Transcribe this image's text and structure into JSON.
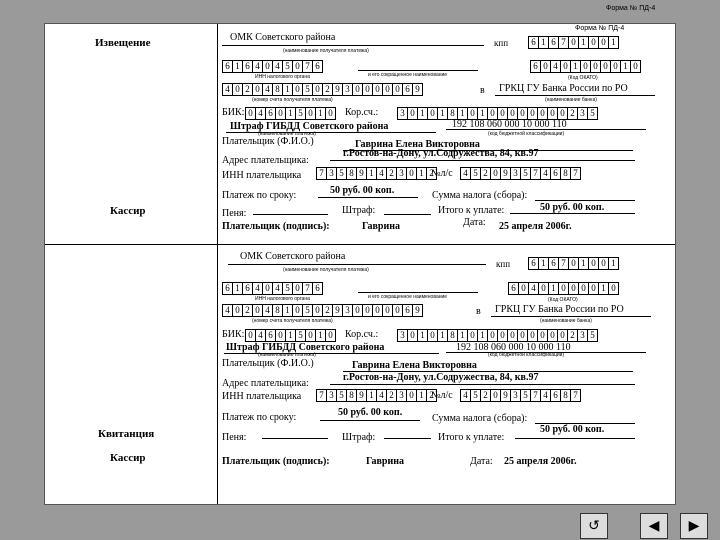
{
  "outer_title": "Форма № ПД-4",
  "form_title": "Форма № ПД-4",
  "section1_label": "Извещение",
  "section1_cashier": "Кассир",
  "section2_label": "Квитанция",
  "section2_cashier": "Кассир",
  "recipient": "ОМК Советского района",
  "recipient_caption": "(наименование получателя платежа)",
  "kpp_label": "кпп",
  "kpp": [
    "6",
    "1",
    "6",
    "7",
    "0",
    "1",
    "0",
    "0",
    "1"
  ],
  "inn": [
    "6",
    "1",
    "6",
    "4",
    "0",
    "4",
    "5",
    "0",
    "7",
    "6"
  ],
  "inn_caption": "ИНН налогового органа",
  "okato": [
    "6",
    "0",
    "4",
    "0",
    "1",
    "0",
    "0",
    "0",
    "0",
    "1",
    "0"
  ],
  "okato_caption": "(Код ОКАТО)",
  "okato_left_caption": "и его сокращенное наименование",
  "account": [
    "4",
    "0",
    "2",
    "0",
    "4",
    "8",
    "1",
    "0",
    "5",
    "0",
    "2",
    "9",
    "3",
    "0",
    "0",
    "0",
    "0",
    "0",
    "6",
    "9"
  ],
  "account_caption": "(номер счета получателя платежа)",
  "in_label": "в",
  "bank": "ГРКЦ ГУ Банка России по РО",
  "bank_caption": "(наименование банка)",
  "bik_label": "БИК:",
  "bik": [
    "0",
    "4",
    "6",
    "0",
    "1",
    "5",
    "0",
    "1",
    "0"
  ],
  "corr_label": "Кор.сч.:",
  "corr": [
    "3",
    "0",
    "1",
    "0",
    "1",
    "8",
    "1",
    "0",
    "1",
    "0",
    "0",
    "0",
    "0",
    "0",
    "0",
    "0",
    "0",
    "2",
    "3",
    "5"
  ],
  "payment_name": "Штраф ГИБДД Советского района",
  "payment_caption": "(наименование платежа)",
  "budget_code": "192 108 060 000 10 000 110",
  "budget_caption": "(код бюджетной классификации)",
  "payer_label": "Плательщик (Ф.И.О.)",
  "payer": "Гаврина Елена Викторовна",
  "address_label": "Адрес плательщика:",
  "address": "г.Ростов-на-Дону, ул.Содружества, 84, кв.97",
  "payer_inn_label": "ИНН плательщика",
  "payer_inn": [
    "7",
    "3",
    "5",
    "8",
    "9",
    "1",
    "4",
    "2",
    "3",
    "0",
    "1",
    "2"
  ],
  "ls_label": "№л/с",
  "ls": [
    "4",
    "5",
    "2",
    "0",
    "9",
    "3",
    "5",
    "7",
    "4",
    "6",
    "8",
    "7"
  ],
  "term_label": "Платеж по сроку:",
  "term_amount": "50 руб. 00 коп.",
  "tax_label": "Сумма налога (сбора):",
  "penalty_label": "Пеня:",
  "fine_label": "Штраф:",
  "total_label": "Итого к уплате:",
  "total_amount": "50 руб. 00 коп.",
  "date_label": "Дата:",
  "date": "25 апреля 2006г.",
  "sign_label": "Плательщик (подпись):",
  "sign_name": "Гаврина"
}
